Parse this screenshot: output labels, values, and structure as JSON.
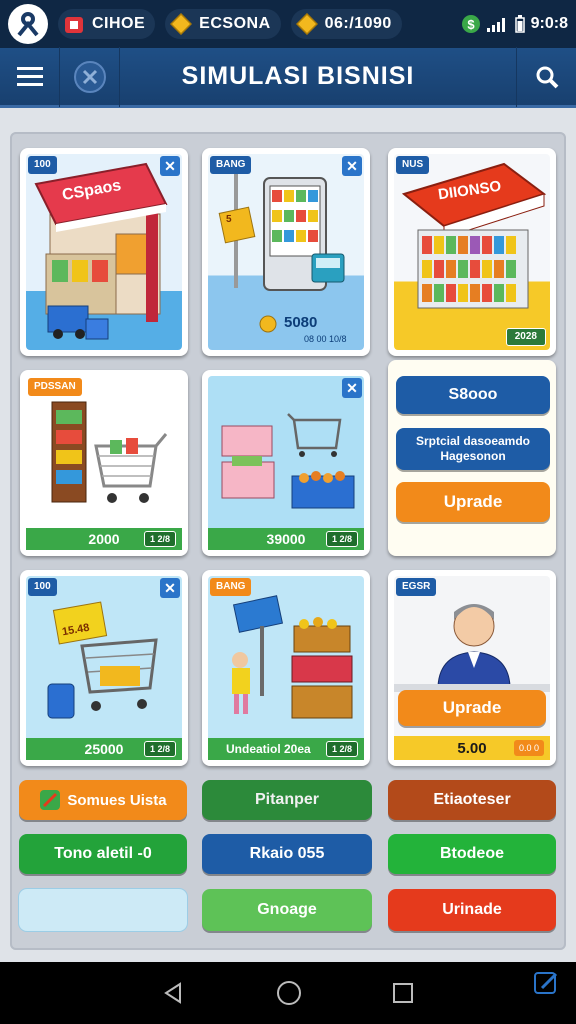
{
  "status": {
    "pill1": "CIHOE",
    "pill2": "ECSONA",
    "pill3": "06:/1090",
    "time": "9:0:8"
  },
  "header": {
    "title": "SIMULASI BISNISI"
  },
  "grid": {
    "card1": {
      "tag": "100",
      "sign": "CSpaos"
    },
    "card2": {
      "tag": "BANG",
      "sign": "5",
      "price": "5080",
      "subprice": "08 00 10/8"
    },
    "card3": {
      "tag": "NUS",
      "sign": "DIIONSO",
      "price": "2028"
    },
    "card4": {
      "tag": "PDSSAN",
      "price": "2000",
      "mini": "1 2/8"
    },
    "card5": {
      "price": "39000",
      "mini": "1 2/8"
    },
    "side": {
      "btn1": "S8ooo",
      "btn2_line1": "Srptcial dasoeamdo",
      "btn2_line2": "Hagesonon",
      "btn3": "Uprade"
    },
    "card7": {
      "tag": "100",
      "sign": "15.48",
      "price": "25000",
      "mini": "1 2/8"
    },
    "card8": {
      "tag": "BANG",
      "price": "Undeatiol 20ea",
      "mini": "1 2/8"
    },
    "card9": {
      "tag": "EGSR",
      "upgrade": "Uprade",
      "price": "5.00",
      "mini": "0.0 0"
    }
  },
  "actions": {
    "row1": [
      "Somues Uista",
      "Pitanper",
      "Etiaoteser"
    ],
    "row2": [
      "Tono aletil -0",
      "Rkaio 055",
      "Btodeoe"
    ],
    "row3": [
      "",
      "Gnoage",
      "Urinade"
    ]
  },
  "colors": {
    "header_bg": "#1f4f86",
    "green": "#3aa848",
    "orange": "#f28a1a",
    "blue": "#1e5ca6",
    "red": "#e53a1c"
  }
}
